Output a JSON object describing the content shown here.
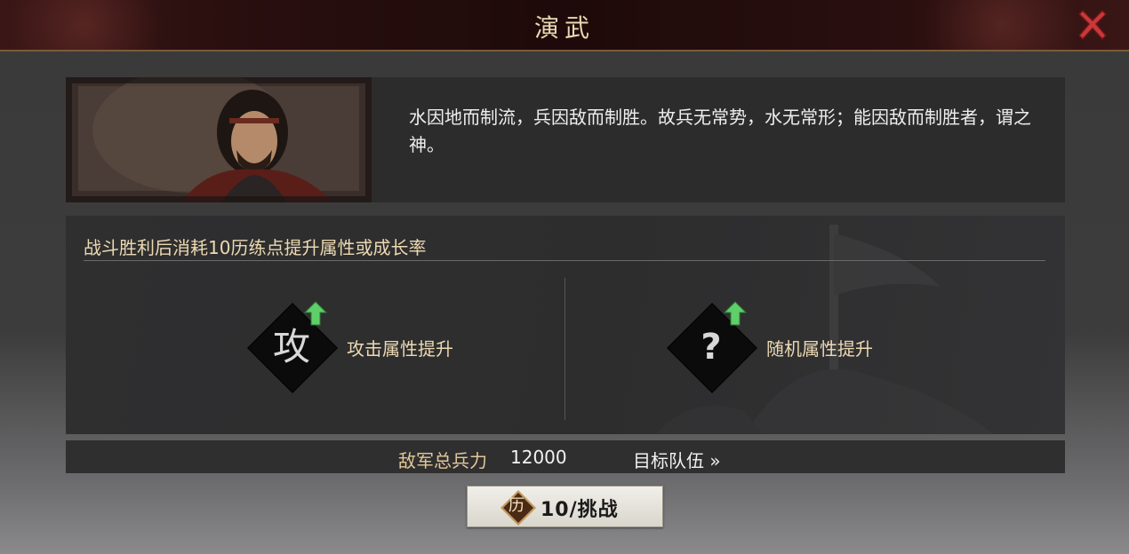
{
  "window": {
    "title": "演武"
  },
  "hero": {
    "quote": "水因地而制流，兵因敌而制胜。故兵无常势，水无常形；能因敌而制胜者，谓之神。"
  },
  "training": {
    "heading": "战斗胜利后消耗10历练点提升属性或成长率",
    "options": [
      {
        "glyph": "攻",
        "label": "攻击属性提升",
        "icon": "attack-icon"
      },
      {
        "glyph": "?",
        "label": "随机属性提升",
        "icon": "random-icon"
      }
    ]
  },
  "enemy": {
    "label": "敌军总兵力",
    "value": "12000",
    "target_link": "目标队伍 »"
  },
  "challenge": {
    "cost_glyph": "历",
    "label": "10/挑战"
  },
  "colors": {
    "title": "#e9d8b0",
    "accent_gold": "#ecd9b2",
    "close_red": "#c9383a",
    "arrow_green": "#5fcf6a"
  }
}
